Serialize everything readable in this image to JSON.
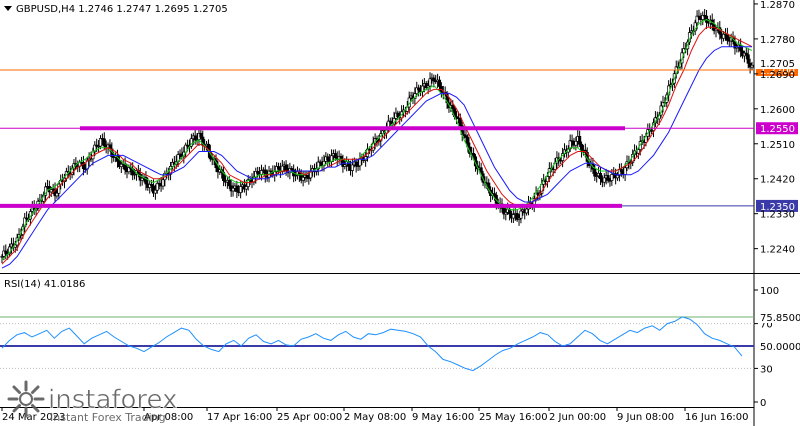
{
  "chart_data": [
    {
      "type": "candlestick",
      "title": "GBPUSD,H4  1.2746 1.2747 1.2695 1.2705",
      "symbol_header": "GBPUSD,H4",
      "ohlc_header": "1.2746 1.2747 1.2695 1.2705",
      "ylim": [
        1.2185,
        1.2875
      ],
      "y_ticks": [
        "1.2870",
        "1.2780",
        "1.2690",
        "1.2600",
        "1.2510",
        "1.2420",
        "1.2330",
        "1.2240"
      ],
      "x_ticks": [
        "24 Mar 2023",
        "Apr 08:00",
        "17 Apr 16:00",
        "25 Apr 00:00",
        "2 May 08:00",
        "9 May 16:00",
        "25 May 16:00",
        "2 Jun 00:00",
        "9 Jun 08:00",
        "16 Jun 16:00"
      ],
      "horizontal_levels": [
        {
          "label": "1.2700",
          "value": 1.27,
          "color": "#ff6a00"
        },
        {
          "label": "1.2550",
          "value": 1.255,
          "color": "#cc00cc"
        },
        {
          "label": "1.2350",
          "value": 1.235,
          "color": "#3a3aa8"
        }
      ],
      "current_price_label": "1.2705",
      "support_resistance_segments": [
        {
          "value": 1.255,
          "color": "#cc00cc"
        },
        {
          "value": 1.235,
          "color": "#cc00cc"
        }
      ],
      "close_path": [
        1.222,
        1.224,
        1.226,
        1.231,
        1.234,
        1.236,
        1.24,
        1.238,
        1.242,
        1.244,
        1.246,
        1.245,
        1.249,
        1.252,
        1.25,
        1.247,
        1.245,
        1.244,
        1.243,
        1.241,
        1.239,
        1.241,
        1.244,
        1.247,
        1.249,
        1.252,
        1.253,
        1.25,
        1.246,
        1.243,
        1.24,
        1.239,
        1.24,
        1.242,
        1.244,
        1.243,
        1.244,
        1.245,
        1.244,
        1.243,
        1.242,
        1.244,
        1.246,
        1.247,
        1.248,
        1.246,
        1.245,
        1.246,
        1.248,
        1.251,
        1.253,
        1.256,
        1.258,
        1.259,
        1.263,
        1.265,
        1.266,
        1.268,
        1.265,
        1.261,
        1.258,
        1.253,
        1.248,
        1.244,
        1.24,
        1.237,
        1.234,
        1.233,
        1.232,
        1.234,
        1.236,
        1.239,
        1.243,
        1.246,
        1.248,
        1.251,
        1.252,
        1.248,
        1.244,
        1.242,
        1.242,
        1.243,
        1.244,
        1.247,
        1.25,
        1.253,
        1.256,
        1.26,
        1.265,
        1.27,
        1.275,
        1.28,
        1.284,
        1.283,
        1.281,
        1.279,
        1.278,
        1.276,
        1.274,
        1.2705
      ],
      "series": [
        {
          "name": "fast MA",
          "color": "#18c818",
          "values": [
            1.221,
            1.223,
            1.226,
            1.23,
            1.233,
            1.236,
            1.239,
            1.24,
            1.242,
            1.244,
            1.246,
            1.247,
            1.249,
            1.25,
            1.25,
            1.248,
            1.246,
            1.245,
            1.243,
            1.242,
            1.241,
            1.242,
            1.244,
            1.246,
            1.248,
            1.251,
            1.252,
            1.25,
            1.247,
            1.244,
            1.242,
            1.241,
            1.241,
            1.242,
            1.243,
            1.243,
            1.244,
            1.244,
            1.244,
            1.243,
            1.243,
            1.244,
            1.245,
            1.246,
            1.247,
            1.247,
            1.246,
            1.247,
            1.249,
            1.251,
            1.253,
            1.255,
            1.257,
            1.259,
            1.262,
            1.264,
            1.265,
            1.266,
            1.264,
            1.261,
            1.257,
            1.252,
            1.248,
            1.244,
            1.24,
            1.237,
            1.235,
            1.234,
            1.234,
            1.235,
            1.237,
            1.24,
            1.243,
            1.246,
            1.248,
            1.25,
            1.25,
            1.248,
            1.245,
            1.244,
            1.244,
            1.244,
            1.245,
            1.247,
            1.25,
            1.253,
            1.256,
            1.259,
            1.264,
            1.269,
            1.274,
            1.279,
            1.282,
            1.283,
            1.282,
            1.28,
            1.279,
            1.277,
            1.276,
            1.275
          ]
        },
        {
          "name": "mid MA",
          "color": "#e01010",
          "values": [
            1.22,
            1.222,
            1.224,
            1.228,
            1.231,
            1.234,
            1.237,
            1.239,
            1.241,
            1.243,
            1.245,
            1.246,
            1.248,
            1.249,
            1.25,
            1.249,
            1.247,
            1.246,
            1.244,
            1.243,
            1.242,
            1.242,
            1.243,
            1.245,
            1.247,
            1.249,
            1.251,
            1.25,
            1.248,
            1.246,
            1.243,
            1.242,
            1.241,
            1.241,
            1.242,
            1.243,
            1.243,
            1.244,
            1.244,
            1.244,
            1.243,
            1.244,
            1.244,
            1.245,
            1.246,
            1.247,
            1.247,
            1.247,
            1.248,
            1.25,
            1.252,
            1.254,
            1.256,
            1.258,
            1.26,
            1.262,
            1.264,
            1.265,
            1.265,
            1.263,
            1.26,
            1.256,
            1.252,
            1.248,
            1.244,
            1.241,
            1.238,
            1.236,
            1.235,
            1.235,
            1.236,
            1.238,
            1.241,
            1.244,
            1.246,
            1.248,
            1.249,
            1.249,
            1.247,
            1.245,
            1.244,
            1.244,
            1.245,
            1.246,
            1.248,
            1.251,
            1.254,
            1.257,
            1.261,
            1.266,
            1.27,
            1.275,
            1.279,
            1.281,
            1.281,
            1.28,
            1.279,
            1.278,
            1.277,
            1.276
          ]
        },
        {
          "name": "slow MA",
          "color": "#1a1aff",
          "values": [
            1.219,
            1.22,
            1.222,
            1.225,
            1.228,
            1.231,
            1.234,
            1.236,
            1.238,
            1.24,
            1.242,
            1.244,
            1.246,
            1.247,
            1.248,
            1.248,
            1.248,
            1.247,
            1.246,
            1.245,
            1.244,
            1.243,
            1.243,
            1.244,
            1.245,
            1.247,
            1.249,
            1.249,
            1.249,
            1.248,
            1.246,
            1.244,
            1.243,
            1.242,
            1.242,
            1.242,
            1.243,
            1.243,
            1.244,
            1.244,
            1.244,
            1.244,
            1.244,
            1.245,
            1.245,
            1.246,
            1.246,
            1.247,
            1.247,
            1.248,
            1.25,
            1.252,
            1.254,
            1.256,
            1.258,
            1.26,
            1.262,
            1.263,
            1.264,
            1.264,
            1.263,
            1.261,
            1.257,
            1.253,
            1.249,
            1.245,
            1.242,
            1.239,
            1.237,
            1.236,
            1.236,
            1.237,
            1.238,
            1.24,
            1.242,
            1.244,
            1.245,
            1.246,
            1.246,
            1.245,
            1.244,
            1.243,
            1.243,
            1.243,
            1.244,
            1.246,
            1.248,
            1.251,
            1.254,
            1.258,
            1.262,
            1.266,
            1.27,
            1.273,
            1.275,
            1.276,
            1.276,
            1.276,
            1.276,
            1.276
          ]
        }
      ]
    },
    {
      "type": "line",
      "title": "RSI(14) 41.0186",
      "header": "RSI(14) 41.0186",
      "ylim": [
        0,
        100
      ],
      "y_ticks": [
        "100",
        "70",
        "30",
        "0"
      ],
      "levels": [
        {
          "label": "75.8500",
          "value": 75.85,
          "color": "#6fb26f"
        },
        {
          "label": "50.0000",
          "value": 50.0,
          "color": "#3a3aa8"
        }
      ],
      "dotted_levels": [
        70,
        30
      ],
      "series": [
        {
          "color": "#1e90ff",
          "values": [
            48,
            55,
            60,
            62,
            58,
            61,
            64,
            57,
            63,
            66,
            59,
            52,
            57,
            60,
            63,
            58,
            54,
            50,
            48,
            45,
            49,
            53,
            58,
            62,
            66,
            64,
            56,
            50,
            47,
            45,
            52,
            55,
            50,
            57,
            60,
            54,
            52,
            55,
            51,
            50,
            56,
            58,
            61,
            57,
            55,
            60,
            63,
            58,
            56,
            61,
            60,
            62,
            65,
            64,
            63,
            61,
            58,
            50,
            45,
            38,
            36,
            33,
            30,
            28,
            32,
            37,
            42,
            46,
            48,
            52,
            55,
            58,
            62,
            60,
            54,
            50,
            52,
            58,
            64,
            61,
            55,
            52,
            56,
            60,
            64,
            62,
            66,
            68,
            64,
            70,
            72,
            76,
            74,
            69,
            61,
            57,
            55,
            52,
            49,
            41
          ]
        }
      ]
    }
  ],
  "watermark": {
    "brand": "instaforex",
    "tagline": "Instant Forex Trading",
    "icon": "instaforex-starburst-logo-icon"
  }
}
